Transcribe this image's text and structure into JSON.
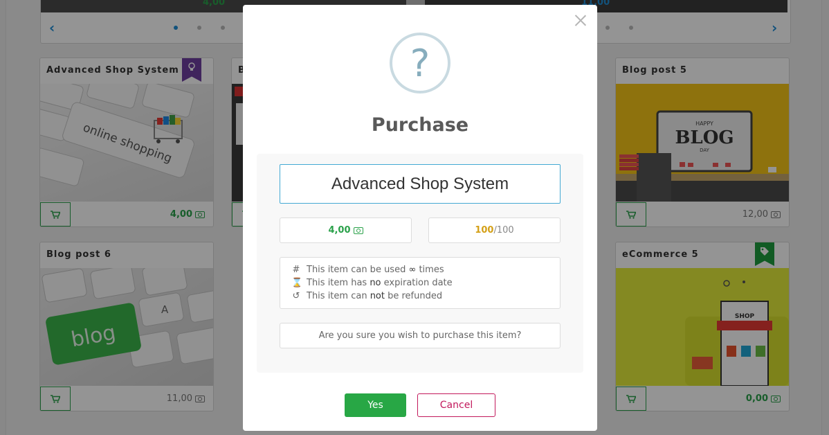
{
  "modal": {
    "icon": "?",
    "title": "Purchase",
    "item_name": "Advanced Shop System",
    "price": "4,00",
    "stock": {
      "current": "100",
      "total": "/100"
    },
    "info": [
      {
        "icon": "hash-icon",
        "glyph": "#",
        "pre": "This item can be used ",
        "em": "∞",
        "post": " times"
      },
      {
        "icon": "hourglass-icon",
        "glyph": "⌛",
        "pre": "This item has ",
        "em": "no",
        "post": " expiration date"
      },
      {
        "icon": "undo-icon",
        "glyph": "↺",
        "pre": "This item can ",
        "em": "not",
        "post": " be refunded"
      }
    ],
    "confirm_text": "Are you sure you wish to purchase this item?",
    "yes_label": "Yes",
    "cancel_label": "Cancel"
  },
  "carousel": {
    "price_left": "4,00",
    "price_right": "11,00"
  },
  "cards": [
    {
      "title": "Advanced Shop System",
      "price": "4,00",
      "price_green": true
    },
    {
      "title": "B",
      "price": ""
    },
    {
      "title": "Blog post 5",
      "price": "12,00",
      "price_green": false
    },
    {
      "title": "Blog post 6",
      "price": "11,00",
      "price_green": false
    },
    {
      "title": "eCommerce 5",
      "price": "0,00",
      "price_green": true
    }
  ],
  "colors": {
    "accent_green": "#28a745",
    "cancel": "#c2185b",
    "info_blue": "#43a9d4"
  }
}
